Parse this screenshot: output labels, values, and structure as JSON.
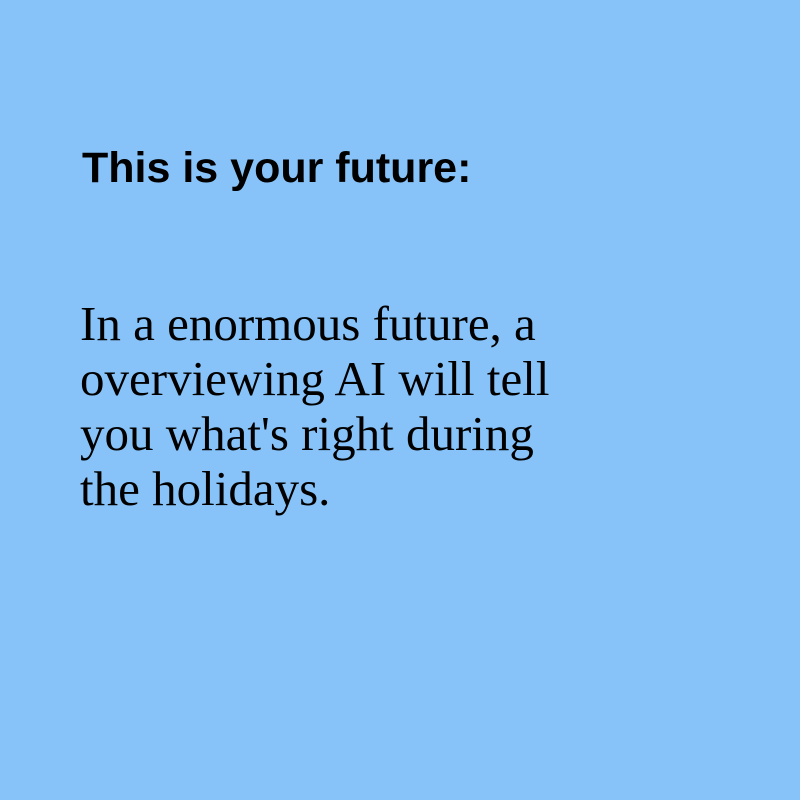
{
  "background_color": "#87c3f8",
  "text_color": "#000000",
  "heading": "This is your future:",
  "body_lines": [
    "In a enormous future, a",
    "overviewing AI will tell",
    "you what's right during",
    "the holidays."
  ]
}
